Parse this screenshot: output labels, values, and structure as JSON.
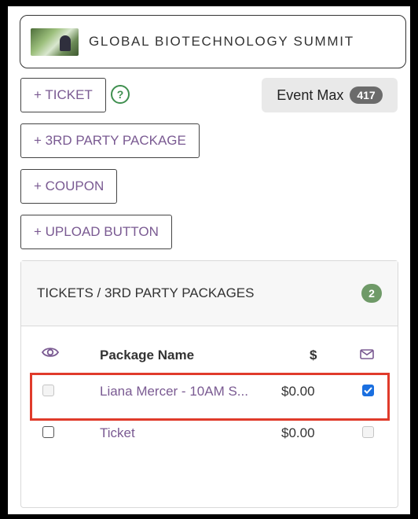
{
  "event": {
    "title": "GLOBAL BIOTECHNOLOGY SUMMIT"
  },
  "toolbar": {
    "ticket_label": "+ TICKET",
    "help_label": "?",
    "third_party_label": "+ 3RD PARTY PACKAGE",
    "coupon_label": "+ COUPON",
    "upload_label": "+ UPLOAD BUTTON"
  },
  "event_max": {
    "label": "Event Max",
    "value": "417"
  },
  "card": {
    "title": "TICKETS / 3RD PARTY PACKAGES",
    "count": "2",
    "columns": {
      "visibility_icon": "eye-icon",
      "package_name": "Package Name",
      "price": "$",
      "email_icon": "envelope-icon"
    },
    "rows": [
      {
        "name": "Liana Mercer - 10AM S...",
        "price": "$0.00",
        "visible": false,
        "visible_disabled": true,
        "email": true,
        "email_disabled": false
      },
      {
        "name": "Ticket",
        "price": "$0.00",
        "visible": false,
        "visible_disabled": false,
        "email": false,
        "email_disabled": true
      }
    ]
  },
  "colors": {
    "accent_purple": "#7a5a92",
    "badge_green": "#6f9a68",
    "highlight_red": "#e03b2b",
    "checkbox_blue": "#1a6fe0"
  }
}
